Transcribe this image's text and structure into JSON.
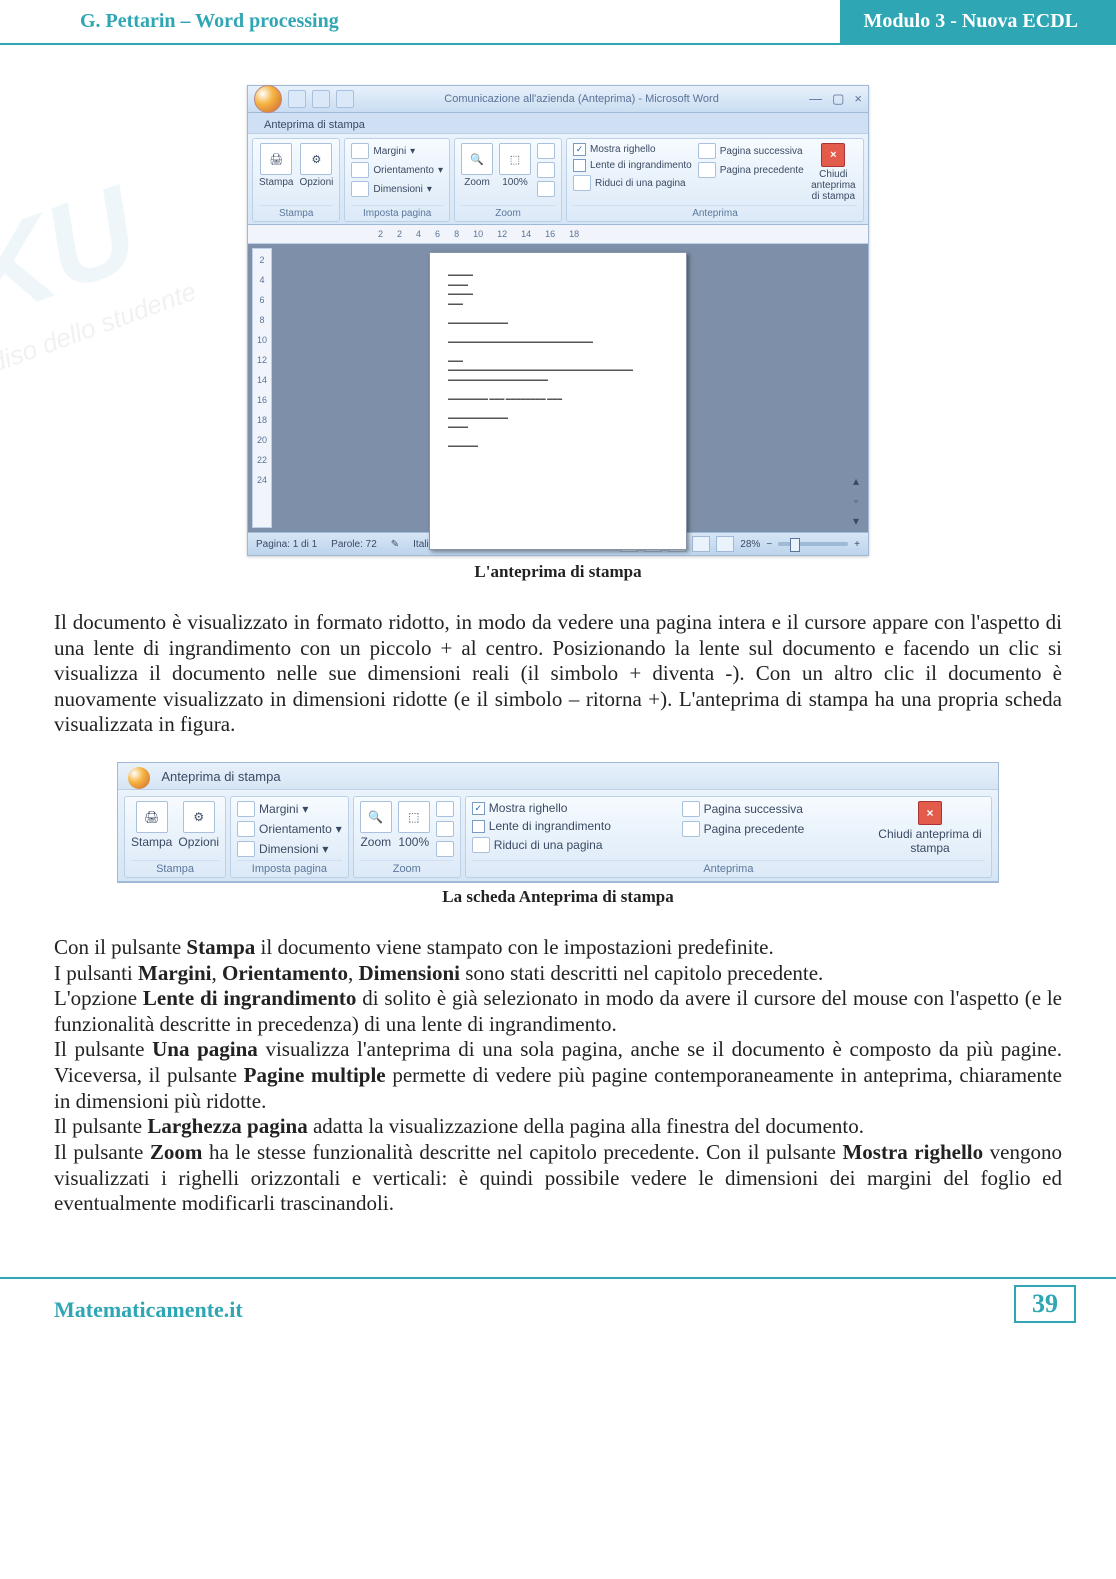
{
  "header": {
    "left": "G. Pettarin – Word processing",
    "right": "Modulo 3 - Nuova ECDL"
  },
  "watermark": {
    "big": "SKU",
    "sub": "il Paradiso dello studente"
  },
  "figure1": {
    "title": "Comunicazione all'azienda (Anteprima) - Microsoft Word",
    "tab": "Anteprima di stampa",
    "groups": {
      "stampa": {
        "print": "Stampa",
        "options": "Opzioni",
        "label": "Stampa"
      },
      "imposta": {
        "margini": "Margini",
        "orient": "Orientamento",
        "dim": "Dimensioni",
        "label": "Imposta pagina"
      },
      "zoom": {
        "zoom": "Zoom",
        "pct": "100%",
        "label": "Zoom"
      },
      "anteprima": {
        "righello": "Mostra righello",
        "lente": "Lente di ingrandimento",
        "riduci": "Riduci di una pagina",
        "succ": "Pagina successiva",
        "prec": "Pagina precedente",
        "chiudi": "Chiudi anteprima di stampa",
        "label": "Anteprima"
      }
    },
    "ruler": [
      "2",
      "2",
      "4",
      "6",
      "8",
      "10",
      "12",
      "14",
      "16",
      "18"
    ],
    "vruler": [
      "2",
      "4",
      "6",
      "8",
      "10",
      "12",
      "14",
      "16",
      "18",
      "20",
      "22",
      "24"
    ],
    "status": {
      "page": "Pagina: 1 di 1",
      "words": "Parole: 72",
      "lang": "Italiano (Italia)",
      "zoom": "28%"
    },
    "caption": "L'anteprima di stampa"
  },
  "para1": "Il documento è visualizzato in formato ridotto, in modo da vedere una pagina intera e il cursore appare con l'aspetto di una lente di ingrandimento con un piccolo + al centro. Posizionando la lente sul documento e facendo un clic si visualizza il documento nelle sue dimensioni reali (il simbolo + diventa -). Con un altro clic il documento è nuovamente visualizzato in dimensioni ridotte (e il simbolo – ritorna +). L'anteprima di stampa ha una propria scheda visualizzata in figura.",
  "figure2": {
    "caption": "La scheda Anteprima di stampa"
  },
  "para2": {
    "l1a": "Con il pulsante ",
    "l1b": "Stampa",
    "l1c": " il documento viene stampato con le impostazioni predefinite.",
    "l2a": "I pulsanti ",
    "l2b": "Margini",
    "l2c": ", ",
    "l2d": "Orientamento",
    "l2e": ", ",
    "l2f": "Dimensioni",
    "l2g": " sono stati descritti nel capitolo precedente.",
    "l3a": "L'opzione ",
    "l3b": "Lente di ingrandimento",
    "l3c": " di solito è già selezionato in modo da avere il cursore del mouse con l'aspetto (e le funzionalità descritte in precedenza) di una lente di ingrandimento.",
    "l4a": "Il pulsante ",
    "l4b": "Una pagina",
    "l4c": " visualizza l'anteprima di una sola pagina, anche se il documento è composto da più pagine. Viceversa, il pulsante ",
    "l4d": "Pagine multiple",
    "l4e": " permette di vedere più pagine contemporaneamente in anteprima, chiaramente in dimensioni più ridotte.",
    "l5a": "Il pulsante ",
    "l5b": "Larghezza pagina",
    "l5c": " adatta la visualizzazione della pagina alla finestra del documento.",
    "l6a": "Il pulsante ",
    "l6b": "Zoom",
    "l6c": " ha le stesse funzionalità descritte nel capitolo precedente. Con il pulsante ",
    "l6d": "Mostra righello",
    "l6e": " vengono visualizzati i righelli orizzontali e verticali: è quindi possibile vedere le dimensioni dei margini del foglio ed eventualmente modificarli trascinandoli."
  },
  "footer": {
    "site": "Matematicamente.it",
    "page": "39"
  }
}
